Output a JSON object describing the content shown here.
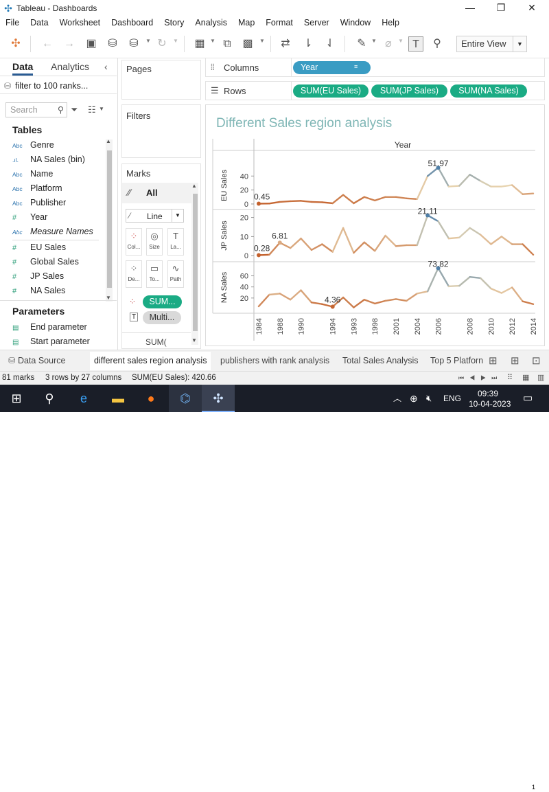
{
  "window": {
    "title": "Tableau - Dashboards",
    "min": "—",
    "max": "❐",
    "close": "✕"
  },
  "menu": [
    "File",
    "Data",
    "Worksheet",
    "Dashboard",
    "Story",
    "Analysis",
    "Map",
    "Format",
    "Server",
    "Window",
    "Help"
  ],
  "toolbar": {
    "fit": "Entire View"
  },
  "datapane": {
    "tab_data": "Data",
    "tab_analytics": "Analytics",
    "datasource": "filter to 100 ranks...",
    "search_placeholder": "Search",
    "tables_title": "Tables",
    "fields": [
      {
        "type": "Abc",
        "name": "Genre"
      },
      {
        "type": ".ıl.",
        "name": "NA Sales (bin)"
      },
      {
        "type": "Abc",
        "name": "Name"
      },
      {
        "type": "Abc",
        "name": "Platform"
      },
      {
        "type": "Abc",
        "name": "Publisher"
      },
      {
        "type": "#",
        "name": "Year"
      },
      {
        "type": "Abc",
        "name": "Measure Names"
      },
      {
        "type": "#",
        "name": "EU Sales"
      },
      {
        "type": "#",
        "name": "Global Sales"
      },
      {
        "type": "#",
        "name": "JP Sales"
      },
      {
        "type": "#",
        "name": "NA Sales"
      }
    ],
    "params_title": "Parameters",
    "params": [
      "End parameter",
      "Start parameter"
    ]
  },
  "cards": {
    "pages": "Pages",
    "filters": "Filters",
    "marks": "Marks",
    "marks_all": "All",
    "mark_type": "Line",
    "mark_buttons": [
      "Col...",
      "Size",
      "La...",
      "De...",
      "To...",
      "Path"
    ],
    "mark_pills": [
      "SUM...",
      "Multi..."
    ],
    "mark_more": "SUM("
  },
  "shelves": {
    "columns_label": "Columns",
    "rows_label": "Rows",
    "columns": [
      "Year"
    ],
    "rows": [
      "SUM(EU Sales)",
      "SUM(JP Sales)",
      "SUM(NA Sales)"
    ]
  },
  "view": {
    "title": "Different Sales region analysis",
    "header": "Year"
  },
  "chart_data": {
    "type": "line",
    "title": "Different Sales region analysis",
    "xlabel": "Year",
    "x_ticks": [
      "1984",
      "1988",
      "1990",
      "1994",
      "1993",
      "1998",
      "2001",
      "2004",
      "2006",
      "2008",
      "2010",
      "2012",
      "2014"
    ],
    "x": [
      1,
      2,
      3,
      4,
      5,
      6,
      7,
      8,
      9,
      10,
      11,
      12,
      13,
      14,
      15,
      16,
      17,
      18,
      19,
      20,
      21,
      22,
      23,
      24,
      25,
      26,
      27
    ],
    "panels": [
      {
        "ylabel": "EU Sales",
        "yticks": [
          0,
          20,
          40
        ],
        "ylim": [
          -2,
          55
        ],
        "values": [
          0.45,
          0.6,
          3,
          4,
          4.5,
          3,
          2.5,
          1,
          13,
          1,
          10,
          5,
          10,
          10,
          8,
          7,
          40,
          51.97,
          25,
          26,
          42,
          33,
          25,
          25,
          27,
          14,
          15
        ],
        "labels": [
          "0.45",
          "51.97"
        ]
      },
      {
        "ylabel": "JP Sales",
        "yticks": [
          0,
          10,
          20
        ],
        "ylim": [
          -1,
          22
        ],
        "values": [
          0.28,
          0.5,
          6.81,
          4,
          9,
          3,
          6,
          2,
          14.5,
          1.5,
          7,
          2.5,
          10.5,
          5,
          5.5,
          5.5,
          21.11,
          18,
          9,
          9.5,
          14.5,
          11,
          6,
          10,
          6,
          6,
          0.5
        ],
        "labels": [
          "0.28",
          "6.81",
          "21.11"
        ]
      },
      {
        "ylabel": "NA Sales",
        "yticks": [
          20,
          40,
          60
        ],
        "ylim": [
          0,
          78
        ],
        "values": [
          5,
          26,
          28,
          17,
          34,
          12,
          9,
          4.36,
          21,
          3,
          17,
          10,
          15,
          18,
          15,
          28,
          32,
          73.82,
          41,
          42,
          58,
          56,
          37,
          29,
          39,
          14,
          9
        ],
        "labels": [
          "4.36",
          "73.82"
        ]
      }
    ],
    "colors": {
      "low": "#c4612c",
      "high": "#4f7fa8",
      "mid": "#e8d6b3"
    }
  },
  "sheettabs": {
    "datasource": "Data Source",
    "tabs": [
      "different sales region analysis",
      "publishers with rank analysis",
      "Total Sales Analysis",
      "Top 5 Platforn"
    ]
  },
  "status": {
    "marks": "81 marks",
    "dims": "3 rows by 27 columns",
    "sum": "SUM(EU Sales): 420.66"
  },
  "taskbar": {
    "lang": "ENG",
    "time": "09:39",
    "date": "10-04-2023",
    "notif": "1"
  }
}
